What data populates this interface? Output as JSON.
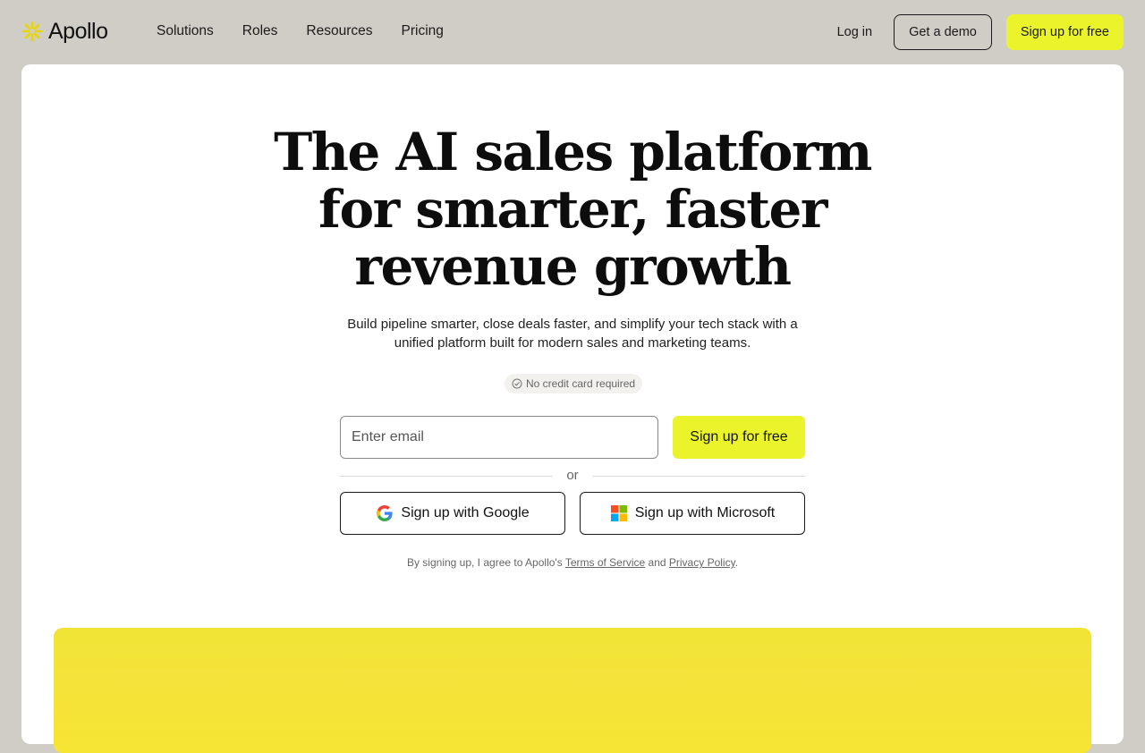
{
  "nav": {
    "logo_text": "Apollo",
    "links": [
      "Solutions",
      "Roles",
      "Resources",
      "Pricing"
    ],
    "login": "Log in",
    "demo": "Get a demo",
    "signup": "Sign up for free"
  },
  "hero": {
    "title_lines": [
      "The AI sales platform",
      "for smarter, faster",
      "revenue growth"
    ],
    "subtitle": "Build pipeline smarter, close deals faster, and simplify your tech stack with a unified platform built for modern sales and marketing teams.",
    "badge": "No credit card required"
  },
  "form": {
    "email_placeholder": "Enter email",
    "submit": "Sign up for free",
    "or": "or",
    "google": "Sign up with Google",
    "microsoft": "Sign up with Microsoft"
  },
  "legal": {
    "prefix": "By signing up, I agree to Apollo's ",
    "terms": "Terms of Service",
    "and": " and ",
    "privacy": "Privacy Policy",
    "suffix": "."
  },
  "colors": {
    "accent": "#ebf42a",
    "page_bg": "#d0cdc6",
    "panel": "#f4e33a"
  }
}
